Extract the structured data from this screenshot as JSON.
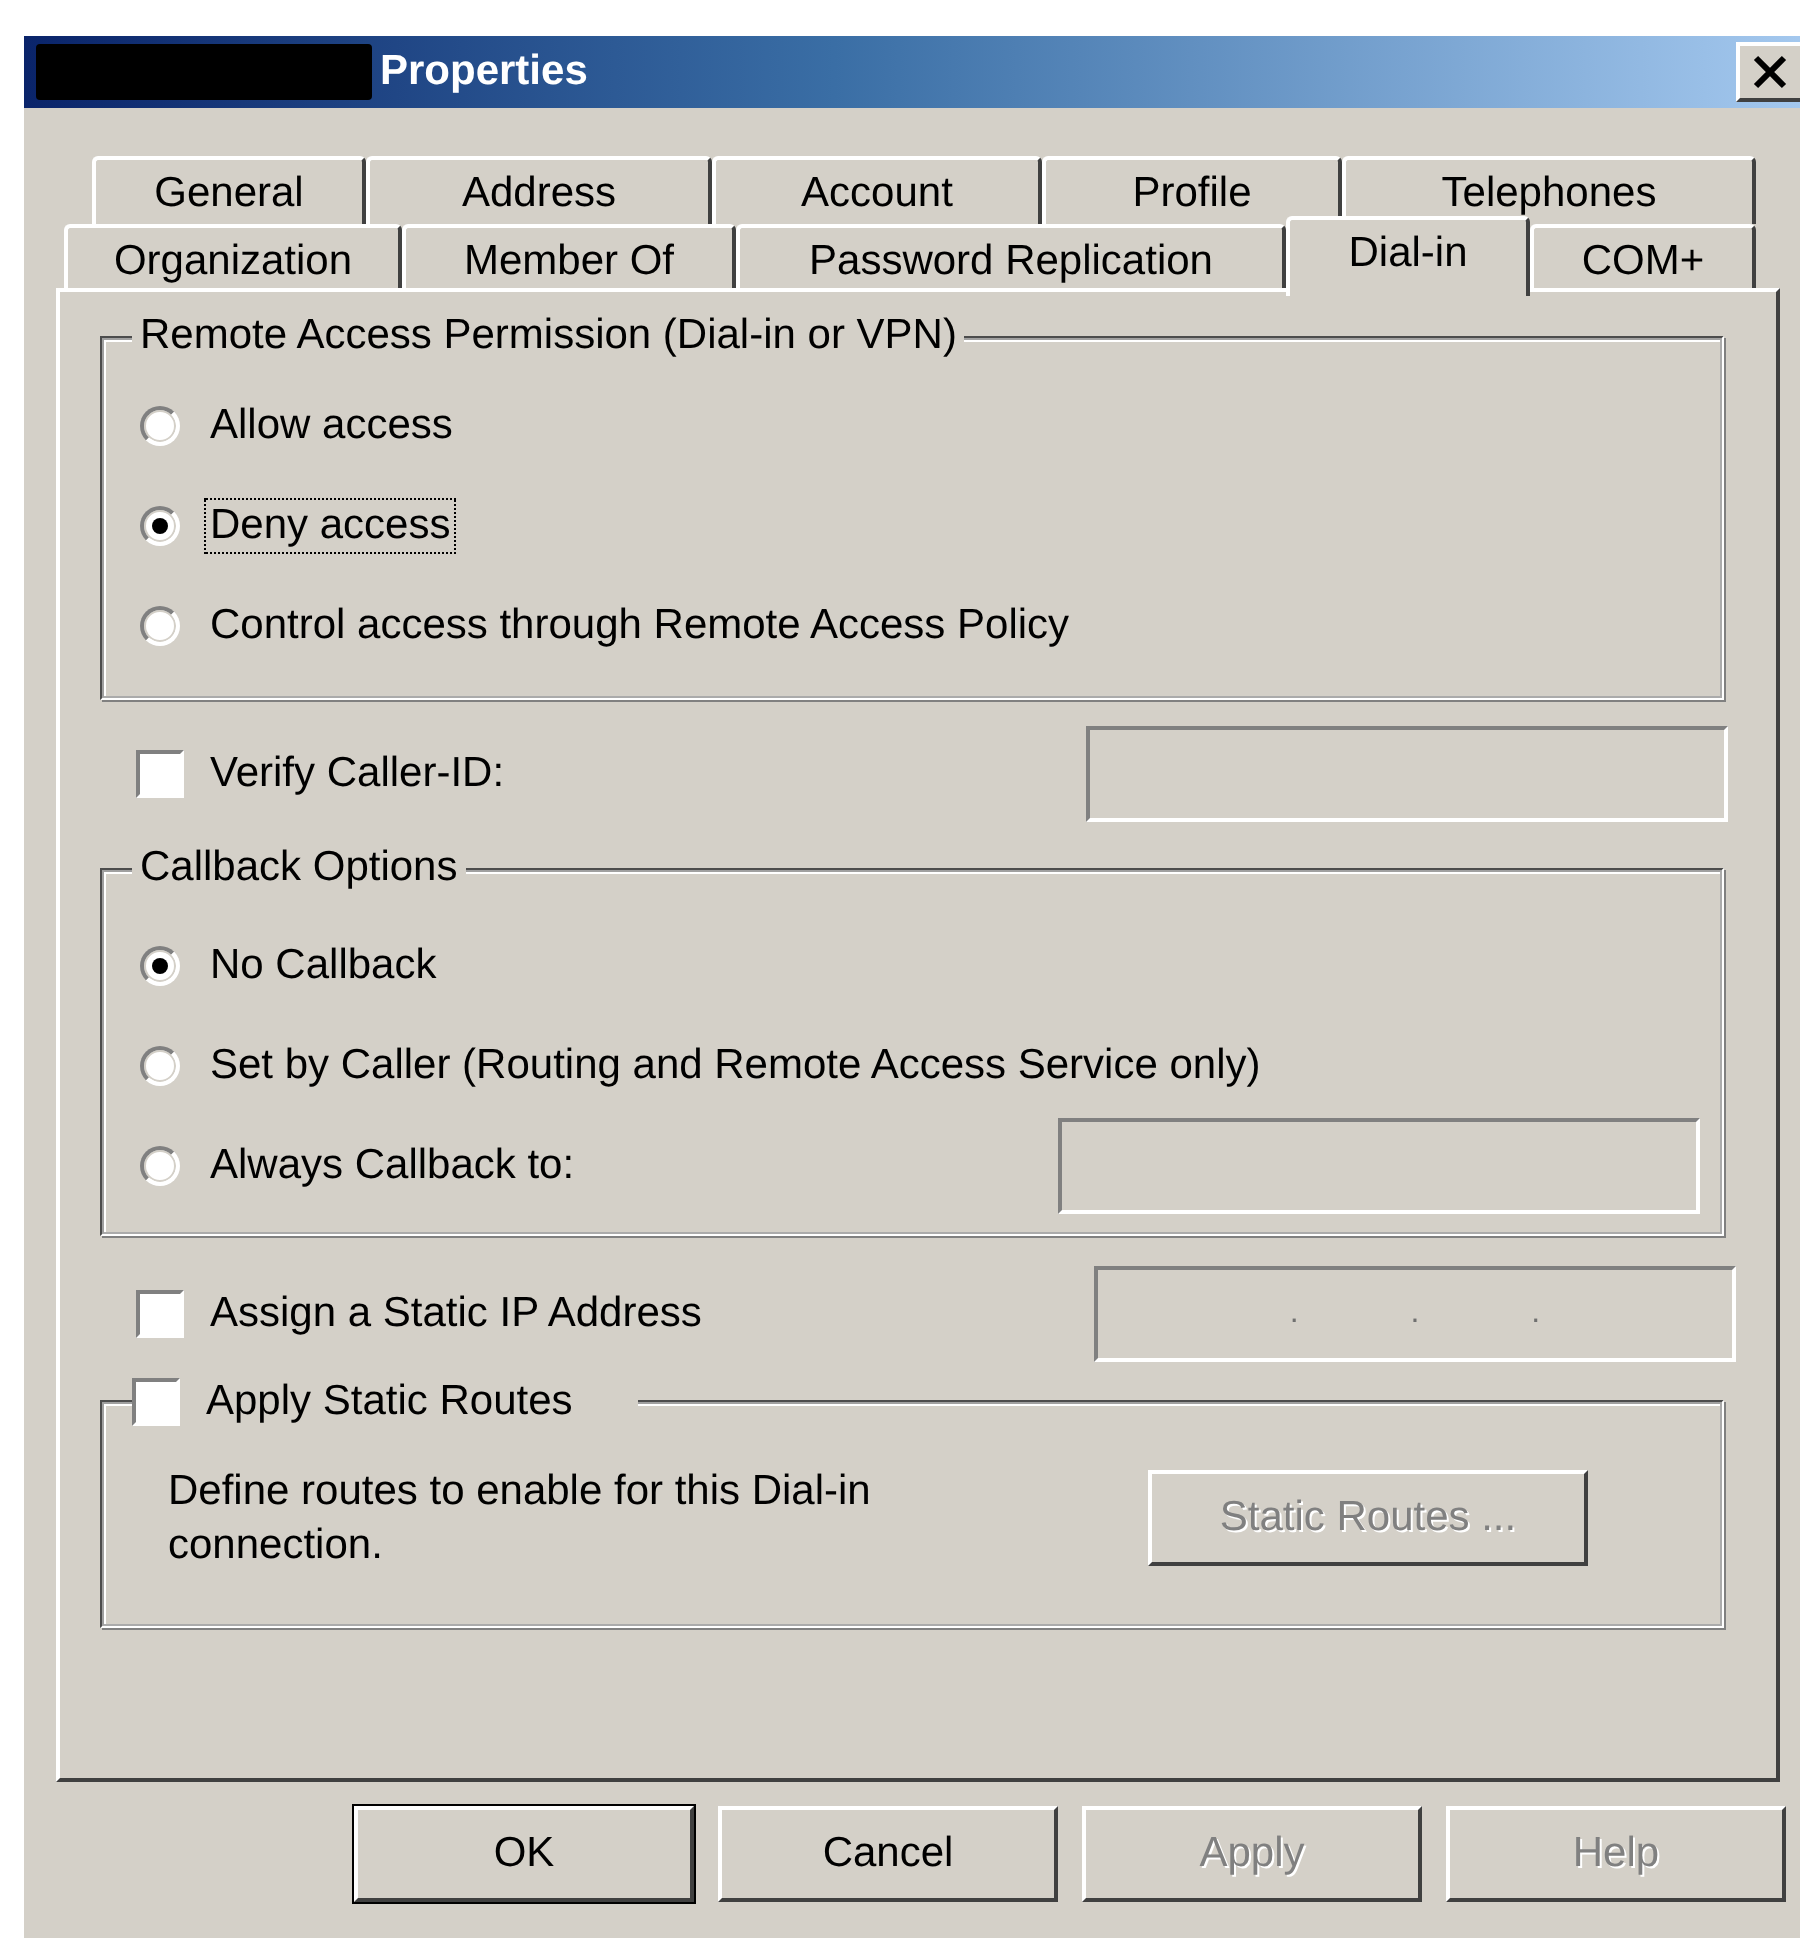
{
  "window": {
    "title": "Properties",
    "redacted": true
  },
  "tab_rows": [
    [
      {
        "label": "General",
        "selected": false
      },
      {
        "label": "Address",
        "selected": false
      },
      {
        "label": "Account",
        "selected": false
      },
      {
        "label": "Profile",
        "selected": false
      },
      {
        "label": "Telephones",
        "selected": false
      }
    ],
    [
      {
        "label": "Organization",
        "selected": false
      },
      {
        "label": "Member Of",
        "selected": false
      },
      {
        "label": "Password Replication",
        "selected": false
      },
      {
        "label": "Dial-in",
        "selected": true
      },
      {
        "label": "COM+",
        "selected": false
      }
    ]
  ],
  "permission_group": {
    "title": "Remote Access Permission (Dial-in or VPN)",
    "options": [
      {
        "label": "Allow access",
        "selected": false,
        "focused": false
      },
      {
        "label": "Deny access",
        "selected": true,
        "focused": true
      },
      {
        "label": "Control access through Remote Access Policy",
        "selected": false,
        "focused": false
      }
    ]
  },
  "verify_caller_id": {
    "label": "Verify Caller-ID:",
    "checked": false,
    "field_disabled": true
  },
  "callback_group": {
    "title": "Callback Options",
    "field_disabled": true,
    "options": [
      {
        "label": "No Callback",
        "selected": true,
        "focused": false
      },
      {
        "label": "Set by Caller (Routing and Remote Access Service only)",
        "selected": false,
        "focused": false
      },
      {
        "label": "Always Callback to:",
        "selected": false,
        "focused": false
      }
    ]
  },
  "static_ip": {
    "label": "Assign a Static IP Address",
    "checked": false,
    "field_disabled": true,
    "separators": [
      ".",
      ".",
      "."
    ]
  },
  "static_routes": {
    "label": "Apply Static Routes",
    "checked": false,
    "description": "Define routes to enable for this Dial-in connection.",
    "button": {
      "label": "Static Routes ...",
      "disabled": true
    }
  },
  "buttons": [
    {
      "label": "OK",
      "default": true,
      "disabled": false
    },
    {
      "label": "Cancel",
      "default": false,
      "disabled": false
    },
    {
      "label": "Apply",
      "default": false,
      "disabled": true
    },
    {
      "label": "Help",
      "default": false,
      "disabled": true
    }
  ]
}
